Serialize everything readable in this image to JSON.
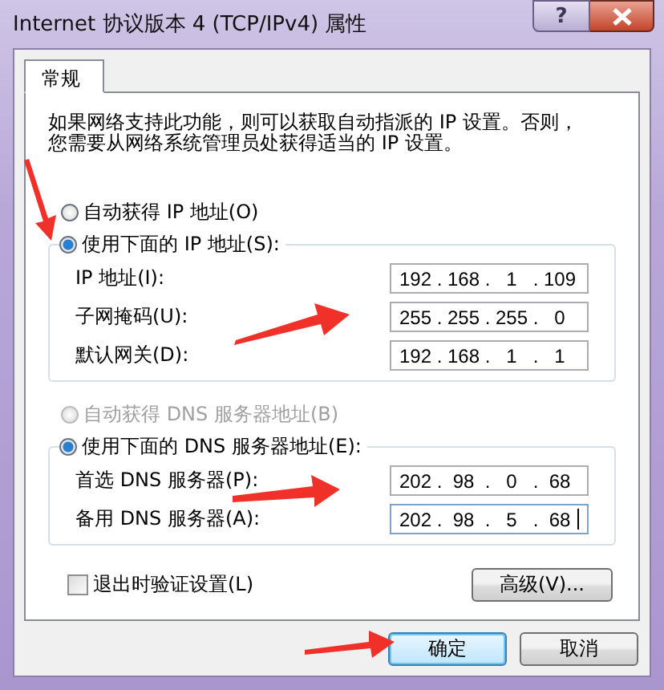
{
  "window": {
    "title": "Internet 协议版本 4 (TCP/IPv4) 属性",
    "help_button": "?"
  },
  "tabs": [
    {
      "label": "常规",
      "selected": true
    }
  ],
  "description": [
    "如果网络支持此功能，则可以获取自动指派的 IP 设置。否则，",
    "您需要从网络系统管理员处获得适当的 IP 设置。"
  ],
  "octet_separator": ".",
  "ip_mode": [
    {
      "label": "自动获得 IP 地址(O)",
      "selected": false,
      "disabled": false
    },
    {
      "label": "使用下面的 IP 地址(S):",
      "selected": true,
      "disabled": false
    }
  ],
  "ip_fields": [
    {
      "label": "IP 地址(I):",
      "octets": [
        "192",
        "168",
        "1",
        "109"
      ],
      "focused": false
    },
    {
      "label": "子网掩码(U):",
      "octets": [
        "255",
        "255",
        "255",
        "0"
      ],
      "focused": false
    },
    {
      "label": "默认网关(D):",
      "octets": [
        "192",
        "168",
        "1",
        "1"
      ],
      "focused": false
    }
  ],
  "dns_mode": [
    {
      "label": "自动获得 DNS 服务器地址(B)",
      "selected": false,
      "disabled": true
    },
    {
      "label": "使用下面的 DNS 服务器地址(E):",
      "selected": true,
      "disabled": false
    }
  ],
  "dns_fields": [
    {
      "label": "首选 DNS 服务器(P):",
      "octets": [
        "202",
        "98",
        "0",
        "68"
      ],
      "focused": false
    },
    {
      "label": "备用 DNS 服务器(A):",
      "octets": [
        "202",
        "98",
        "5",
        "68"
      ],
      "focused": true
    }
  ],
  "validate_checkbox": {
    "label": "退出时验证设置(L)",
    "checked": false
  },
  "advanced_button": "高级(V)...",
  "buttons": [
    {
      "label": "确定",
      "default": true
    },
    {
      "label": "取消",
      "default": false
    }
  ]
}
